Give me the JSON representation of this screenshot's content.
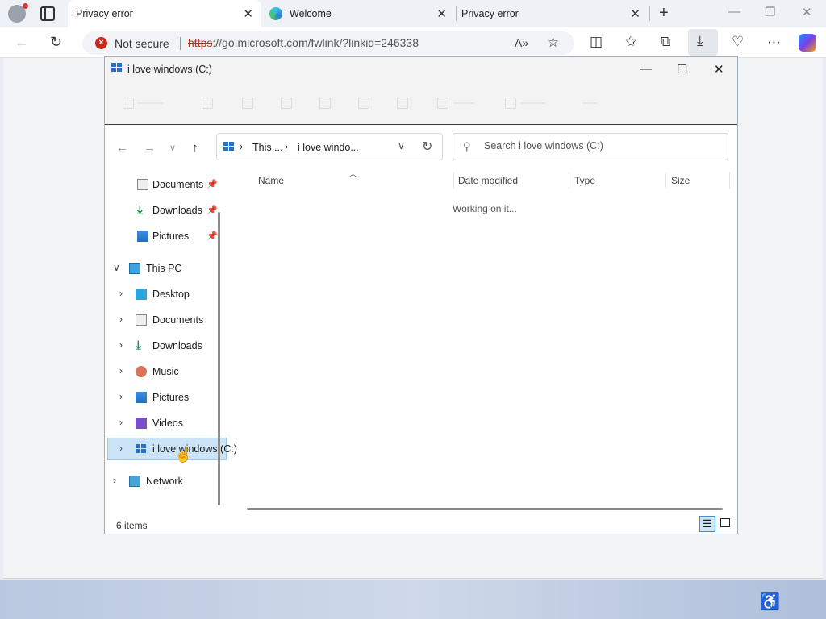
{
  "browser": {
    "tabs": [
      {
        "label": "Privacy error",
        "close": "✕"
      },
      {
        "label": "Welcome",
        "close": "✕"
      },
      {
        "label": "Privacy error",
        "close": "✕"
      }
    ],
    "new_tab": "+",
    "window_controls": {
      "minimize": "—",
      "restore": "❐",
      "close": "✕"
    },
    "address": {
      "security_label": "Not secure",
      "protocol": "https",
      "url_rest": "://go.microsoft.com/fwlink/?linkid=246338"
    },
    "nav": {
      "back": "←",
      "refresh": "↻"
    },
    "toolbar_icons": [
      "read-aloud-icon",
      "favorite-star-icon",
      "split-screen-icon",
      "favorites-icon",
      "collections-icon",
      "download-icon",
      "browser-essentials-icon",
      "more-icon",
      "copilot-icon"
    ]
  },
  "explorer": {
    "title": "i love windows (C:)",
    "controls": {
      "minimize": "—",
      "maximize": "☐",
      "close": "✕"
    },
    "breadcrumb": [
      "This ...",
      "i love windo..."
    ],
    "search_placeholder": "Search i love windows (C:)",
    "sidebar": {
      "quick_access": [
        {
          "label": "Documents",
          "icon": "documents-icon",
          "pinned": true
        },
        {
          "label": "Downloads",
          "icon": "downloads-icon",
          "pinned": true
        },
        {
          "label": "Pictures",
          "icon": "pictures-icon",
          "pinned": true
        }
      ],
      "this_pc": {
        "label": "This PC",
        "icon": "this-pc-icon"
      },
      "this_pc_items": [
        {
          "label": "Desktop",
          "icon": "desktop-icon"
        },
        {
          "label": "Documents",
          "icon": "documents-icon"
        },
        {
          "label": "Downloads",
          "icon": "downloads-icon"
        },
        {
          "label": "Music",
          "icon": "music-icon"
        },
        {
          "label": "Pictures",
          "icon": "pictures-icon"
        },
        {
          "label": "Videos",
          "icon": "videos-icon"
        },
        {
          "label": "i love windows (C:)",
          "icon": "drive-icon",
          "selected": true
        }
      ],
      "network": {
        "label": "Network",
        "icon": "network-icon"
      }
    },
    "columns": [
      "Name",
      "Date modified",
      "Type",
      "Size"
    ],
    "loading_text": "Working on it...",
    "status": "6 items",
    "view_modes": [
      "details-view-icon",
      "tiles-view-icon"
    ]
  },
  "colors": {
    "accent": "#0067c0",
    "selection": "#cce4f7",
    "error": "#c42b1c"
  }
}
